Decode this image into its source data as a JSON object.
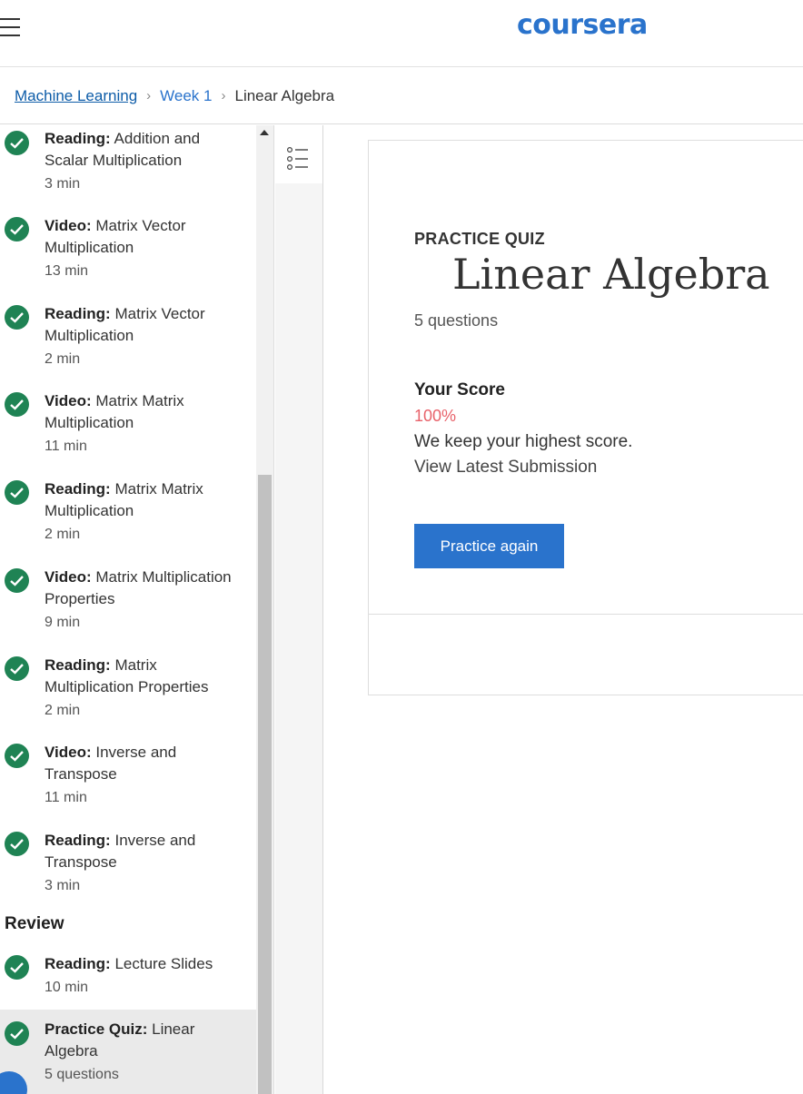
{
  "header": {
    "logo": "coursera"
  },
  "breadcrumb": {
    "course": "Machine Learning",
    "sep1": "›",
    "week": "Week 1",
    "sep2": "›",
    "current": "Linear Algebra"
  },
  "sidebar": {
    "items": [
      {
        "type": "Reading:",
        "name": "Addition and Scalar Multiplication",
        "meta": "3 min"
      },
      {
        "type": "Video:",
        "name": "Matrix Vector Multiplication",
        "meta": "13 min"
      },
      {
        "type": "Reading:",
        "name": "Matrix Vector Multiplication",
        "meta": "2 min"
      },
      {
        "type": "Video:",
        "name": "Matrix Matrix Multiplication",
        "meta": "11 min"
      },
      {
        "type": "Reading:",
        "name": "Matrix Matrix Multiplication",
        "meta": "2 min"
      },
      {
        "type": "Video:",
        "name": "Matrix Multiplication Properties",
        "meta": "9 min"
      },
      {
        "type": "Reading:",
        "name": "Matrix Multiplication Properties",
        "meta": "2 min"
      },
      {
        "type": "Video:",
        "name": "Inverse and Transpose",
        "meta": "11 min"
      },
      {
        "type": "Reading:",
        "name": "Inverse and Transpose",
        "meta": "3 min"
      }
    ],
    "section": "Review",
    "review_items": [
      {
        "type": "Reading:",
        "name": "Lecture Slides",
        "meta": "10 min"
      },
      {
        "type": "Practice Quiz:",
        "name": "Linear Algebra",
        "meta": "5 questions"
      }
    ]
  },
  "quiz": {
    "label": "PRACTICE QUIZ",
    "title": "Linear Algebra",
    "question_count": "5 questions",
    "score_label": "Your Score",
    "score_value": "100%",
    "score_note": "We keep your highest score.",
    "view_latest": "View Latest Submission",
    "practice_button": "Practice again"
  },
  "colors": {
    "brand": "#2a73cc",
    "check": "#1f8354",
    "score": "#e8626a"
  }
}
